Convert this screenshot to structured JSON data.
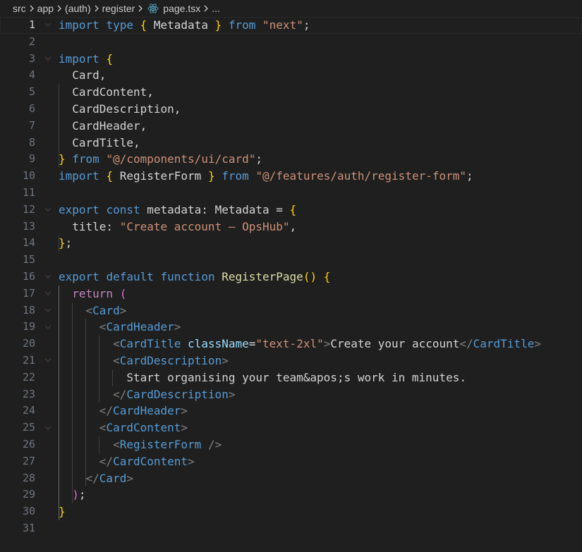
{
  "breadcrumb": {
    "items": [
      "src",
      "app",
      "(auth)",
      "register"
    ],
    "file": "page.tsx",
    "more": "..."
  },
  "editor": {
    "active_line": 1,
    "lines": [
      [
        [
          "kw",
          "import"
        ],
        [
          "id",
          " "
        ],
        [
          "kw",
          "type"
        ],
        [
          "id",
          " "
        ],
        [
          "b1",
          "{"
        ],
        [
          "id",
          " Metadata "
        ],
        [
          "b1",
          "}"
        ],
        [
          "id",
          " "
        ],
        [
          "kw",
          "from"
        ],
        [
          "id",
          " "
        ],
        [
          "str",
          "\"next\""
        ],
        [
          "id",
          ";"
        ]
      ],
      [],
      [
        [
          "kw",
          "import"
        ],
        [
          "id",
          " "
        ],
        [
          "b1",
          "{"
        ]
      ],
      [
        [
          "id",
          "  Card,"
        ]
      ],
      [
        [
          "id",
          "  CardContent,"
        ]
      ],
      [
        [
          "id",
          "  CardDescription,"
        ]
      ],
      [
        [
          "id",
          "  CardHeader,"
        ]
      ],
      [
        [
          "id",
          "  CardTitle,"
        ]
      ],
      [
        [
          "b1",
          "}"
        ],
        [
          "id",
          " "
        ],
        [
          "kw",
          "from"
        ],
        [
          "id",
          " "
        ],
        [
          "str",
          "\"@/components/ui/card\""
        ],
        [
          "id",
          ";"
        ]
      ],
      [
        [
          "kw",
          "import"
        ],
        [
          "id",
          " "
        ],
        [
          "b1",
          "{"
        ],
        [
          "id",
          " RegisterForm "
        ],
        [
          "b1",
          "}"
        ],
        [
          "id",
          " "
        ],
        [
          "kw",
          "from"
        ],
        [
          "id",
          " "
        ],
        [
          "str",
          "\"@/features/auth/register-form\""
        ],
        [
          "id",
          ";"
        ]
      ],
      [],
      [
        [
          "kw",
          "export"
        ],
        [
          "id",
          " "
        ],
        [
          "kw",
          "const"
        ],
        [
          "id",
          " metadata: Metadata = "
        ],
        [
          "b1",
          "{"
        ]
      ],
      [
        [
          "id",
          "  title: "
        ],
        [
          "str",
          "\"Create account — OpsHub\""
        ],
        [
          "id",
          ","
        ]
      ],
      [
        [
          "b1",
          "}"
        ],
        [
          "id",
          ";"
        ]
      ],
      [],
      [
        [
          "kw",
          "export"
        ],
        [
          "id",
          " "
        ],
        [
          "kw",
          "default"
        ],
        [
          "id",
          " "
        ],
        [
          "kw",
          "function"
        ],
        [
          "id",
          " "
        ],
        [
          "fn",
          "RegisterPage"
        ],
        [
          "b1",
          "()"
        ],
        [
          "id",
          " "
        ],
        [
          "b1",
          "{"
        ]
      ],
      [
        [
          "id",
          "  "
        ],
        [
          "ctrl",
          "return"
        ],
        [
          "id",
          " "
        ],
        [
          "b2",
          "("
        ]
      ],
      [
        [
          "id",
          "    "
        ],
        [
          "br",
          "<"
        ],
        [
          "tag",
          "Card"
        ],
        [
          "br",
          ">"
        ]
      ],
      [
        [
          "id",
          "      "
        ],
        [
          "br",
          "<"
        ],
        [
          "tag",
          "CardHeader"
        ],
        [
          "br",
          ">"
        ]
      ],
      [
        [
          "id",
          "        "
        ],
        [
          "br",
          "<"
        ],
        [
          "tag",
          "CardTitle"
        ],
        [
          "id",
          " "
        ],
        [
          "attr",
          "className"
        ],
        [
          "id",
          "="
        ],
        [
          "str",
          "\"text-2xl\""
        ],
        [
          "br",
          ">"
        ],
        [
          "txt",
          "Create your account"
        ],
        [
          "br",
          "</"
        ],
        [
          "tag",
          "CardTitle"
        ],
        [
          "br",
          ">"
        ]
      ],
      [
        [
          "id",
          "        "
        ],
        [
          "br",
          "<"
        ],
        [
          "tag",
          "CardDescription"
        ],
        [
          "br",
          ">"
        ]
      ],
      [
        [
          "txt",
          "          Start organising your team&apos;s work in minutes."
        ]
      ],
      [
        [
          "id",
          "        "
        ],
        [
          "br",
          "</"
        ],
        [
          "tag",
          "CardDescription"
        ],
        [
          "br",
          ">"
        ]
      ],
      [
        [
          "id",
          "      "
        ],
        [
          "br",
          "</"
        ],
        [
          "tag",
          "CardHeader"
        ],
        [
          "br",
          ">"
        ]
      ],
      [
        [
          "id",
          "      "
        ],
        [
          "br",
          "<"
        ],
        [
          "tag",
          "CardContent"
        ],
        [
          "br",
          ">"
        ]
      ],
      [
        [
          "id",
          "        "
        ],
        [
          "br",
          "<"
        ],
        [
          "tag",
          "RegisterForm"
        ],
        [
          "id",
          " "
        ],
        [
          "br",
          "/>"
        ]
      ],
      [
        [
          "id",
          "      "
        ],
        [
          "br",
          "</"
        ],
        [
          "tag",
          "CardContent"
        ],
        [
          "br",
          ">"
        ]
      ],
      [
        [
          "id",
          "    "
        ],
        [
          "br",
          "</"
        ],
        [
          "tag",
          "Card"
        ],
        [
          "br",
          ">"
        ]
      ],
      [
        [
          "id",
          "  "
        ],
        [
          "b2",
          ")"
        ],
        [
          "id",
          ";"
        ]
      ],
      [
        [
          "b1",
          "}"
        ]
      ],
      []
    ],
    "folds": [
      1,
      3,
      12,
      16,
      17,
      18,
      19,
      21,
      25
    ]
  }
}
